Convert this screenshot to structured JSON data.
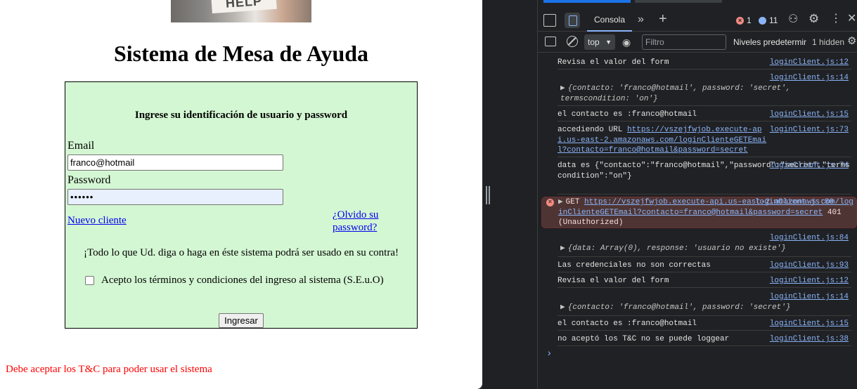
{
  "page": {
    "banner_text": "HELP",
    "title": "Sistema de Mesa de Ayuda",
    "form": {
      "heading": "Ingrese su identificación de usuario y password",
      "email_label": "Email",
      "email_value": "franco@hotmail",
      "password_label": "Password",
      "password_value": "••••••",
      "new_client_link": "Nuevo cliente",
      "forgot_link": "¿Olvido su password?",
      "warning": "¡Todo lo que Ud. diga o haga en éste sistema podrá ser usado en su contra!",
      "terms_label": "Acepto los términos y condiciones del ingreso al sistema (S.E.u.O)",
      "submit_label": "Ingresar"
    },
    "error_message": "Debe aceptar los T&C para poder usar el sistema"
  },
  "devtools": {
    "tab_console": "Consola",
    "error_count": "1",
    "message_count": "11",
    "context": "top",
    "filter_placeholder": "Filtro",
    "levels": "Niveles predetermir",
    "hidden": "1 hidden",
    "messages": [
      {
        "text": "Revisa el valor del form",
        "src": "loginClient.js:12"
      },
      {
        "src": "loginClient.js:14",
        "obj": "{contacto: 'franco@hotmail', password: 'secret', termscondition: 'on'}"
      },
      {
        "text": "el contacto es :franco@hotmail",
        "src": "loginClient.js:15"
      },
      {
        "text": "accediendo URL ",
        "url": "https://vszejfwjob.execute-api.us-east-2.amazonaws.com/loginClienteGETEmail?contacto=franco@hotmail&password=secret",
        "src": "loginClient.js:73"
      },
      {
        "text": "data es {\"contacto\":\"franco@hotmail\",\"password\":\"secret\",\"termscondition\":\"on\"}",
        "src": "loginClient.js:74"
      },
      {
        "text": "GET ",
        "url": "https://vszejfwjob.execute-api.us-east-2.amazonaws.com/loginClienteGETEmail?contacto=franco@hotmail&password=secret",
        "status": " 401 (Unauthorized)",
        "src": "loginClient.js:80"
      },
      {
        "src": "loginClient.js:84",
        "obj": "{data: Array(0), response: 'usuario no existe'}"
      },
      {
        "text": "Las credenciales no son correctas",
        "src": "loginClient.js:93"
      },
      {
        "text": "Revisa el valor del form",
        "src": "loginClient.js:12"
      },
      {
        "src": "loginClient.js:14",
        "obj": "{contacto: 'franco@hotmail', password: 'secret'}"
      },
      {
        "text": "el contacto es :franco@hotmail",
        "src": "loginClient.js:15"
      },
      {
        "text": "no aceptó los T&C no se puede loggear",
        "src": "loginClient.js:38"
      }
    ],
    "prompt": "›"
  }
}
